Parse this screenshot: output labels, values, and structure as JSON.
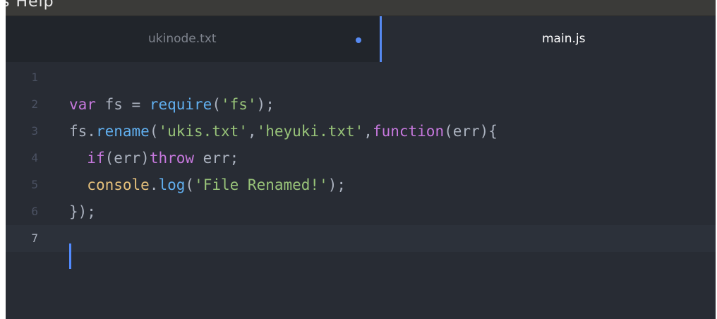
{
  "menubar": {
    "text": "s  Help"
  },
  "tabs": [
    {
      "label": "ukinode.txt",
      "modified": true,
      "active": false
    },
    {
      "label": "main.js",
      "modified": false,
      "active": true
    }
  ],
  "editor": {
    "lines": [
      {
        "num": "1",
        "tokens": []
      },
      {
        "num": "2",
        "tokens": [
          {
            "t": "var",
            "c": "kw"
          },
          {
            "t": " fs = ",
            "c": "punct"
          },
          {
            "t": "require",
            "c": "fn"
          },
          {
            "t": "(",
            "c": "punct"
          },
          {
            "t": "'fs'",
            "c": "str"
          },
          {
            "t": ");",
            "c": "punct"
          }
        ]
      },
      {
        "num": "3",
        "tokens": [
          {
            "t": "fs",
            "c": "punct"
          },
          {
            "t": ".",
            "c": "punct"
          },
          {
            "t": "rename",
            "c": "fn"
          },
          {
            "t": "(",
            "c": "punct"
          },
          {
            "t": "'ukis.txt'",
            "c": "str"
          },
          {
            "t": ",",
            "c": "punct"
          },
          {
            "t": "'heyuki.txt'",
            "c": "str"
          },
          {
            "t": ",",
            "c": "punct"
          },
          {
            "t": "function",
            "c": "kw"
          },
          {
            "t": "(err){",
            "c": "punct"
          }
        ]
      },
      {
        "num": "4",
        "tokens": [
          {
            "t": "  ",
            "c": "punct"
          },
          {
            "t": "if",
            "c": "kw"
          },
          {
            "t": "(err)",
            "c": "punct"
          },
          {
            "t": "throw",
            "c": "kw"
          },
          {
            "t": " err;",
            "c": "punct"
          }
        ]
      },
      {
        "num": "5",
        "tokens": [
          {
            "t": "  ",
            "c": "punct"
          },
          {
            "t": "console",
            "c": "obj"
          },
          {
            "t": ".",
            "c": "punct"
          },
          {
            "t": "log",
            "c": "fn"
          },
          {
            "t": "(",
            "c": "punct"
          },
          {
            "t": "'File Renamed!'",
            "c": "str"
          },
          {
            "t": ");",
            "c": "punct"
          }
        ]
      },
      {
        "num": "6",
        "tokens": [
          {
            "t": "});",
            "c": "punct"
          }
        ]
      },
      {
        "num": "7",
        "tokens": [],
        "active": true
      }
    ]
  },
  "colors": {
    "keyword": "#c678dd",
    "function": "#61afef",
    "string": "#98c379",
    "object": "#e5c07b",
    "text": "#abb2bf",
    "accent": "#568af2"
  }
}
